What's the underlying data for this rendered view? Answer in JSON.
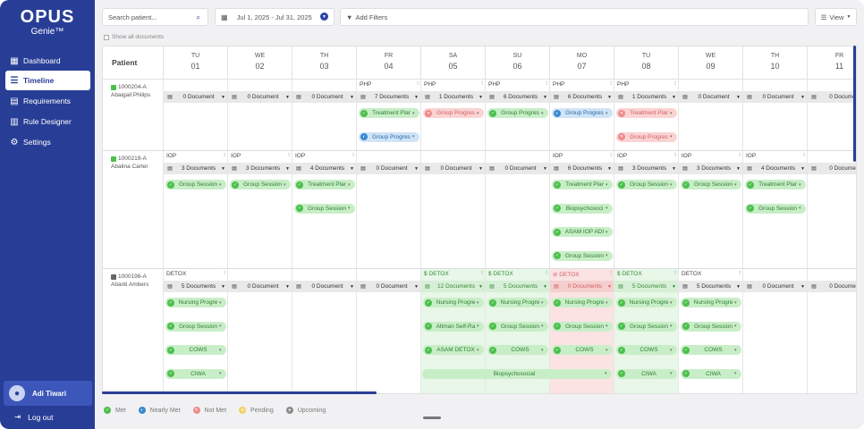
{
  "app": {
    "logo": "OPUS",
    "logo_sub": "Genie™"
  },
  "nav": [
    {
      "label": "Dashboard",
      "icon": "dashboard-icon"
    },
    {
      "label": "Timeline",
      "icon": "timeline-icon"
    },
    {
      "label": "Requirements",
      "icon": "requirements-icon"
    },
    {
      "label": "Rule Designer",
      "icon": "rule-designer-icon"
    },
    {
      "label": "Settings",
      "icon": "gear-icon"
    }
  ],
  "user": {
    "name": "Adi Tiwari",
    "logout": "Log out"
  },
  "toolbar": {
    "search_placeholder": "Search patient...",
    "date_range": "Jul 1, 2025 - Jul 31, 2025",
    "filters": "Add Filters",
    "view": "View"
  },
  "show_all": "Show all documents",
  "grid": {
    "patient_header": "Patient",
    "days": [
      {
        "name": "TU",
        "num": "01"
      },
      {
        "name": "WE",
        "num": "02"
      },
      {
        "name": "TH",
        "num": "03"
      },
      {
        "name": "FR",
        "num": "04"
      },
      {
        "name": "SA",
        "num": "05"
      },
      {
        "name": "SU",
        "num": "06"
      },
      {
        "name": "MO",
        "num": "07"
      },
      {
        "name": "TU",
        "num": "08"
      },
      {
        "name": "WE",
        "num": "09"
      },
      {
        "name": "TH",
        "num": "10"
      },
      {
        "name": "FR",
        "num": "11"
      }
    ],
    "patients": [
      {
        "id": "1000204-A",
        "name": "Abaigail Philips",
        "tag_color": "#4cbf4c",
        "cells": [
          {
            "prog": "",
            "docs": "0 Document",
            "chips": []
          },
          {
            "prog": "",
            "docs": "0 Document",
            "chips": []
          },
          {
            "prog": "",
            "docs": "0 Document",
            "chips": []
          },
          {
            "prog": "PHP",
            "docs": "7 Documents",
            "chips": [
              {
                "t": "Treatment Plar",
                "s": "met",
                "r": 0
              },
              {
                "t": "Group Progres",
                "s": "nearly",
                "r": 1
              }
            ]
          },
          {
            "prog": "PHP",
            "docs": "1 Documents",
            "chips": [
              {
                "t": "Group Progres",
                "s": "notmet",
                "r": 0
              }
            ]
          },
          {
            "prog": "PHP",
            "docs": "6 Documents",
            "chips": [
              {
                "t": "Group Progres",
                "s": "met",
                "r": 0
              }
            ]
          },
          {
            "prog": "PHP",
            "docs": "6 Documents",
            "chips": [
              {
                "t": "Group Progres",
                "s": "nearly",
                "r": 0
              }
            ]
          },
          {
            "prog": "PHP",
            "docs": "1 Documents",
            "chips": [
              {
                "t": "Treatment Plar",
                "s": "notmet",
                "r": 0
              },
              {
                "t": "Group Progres",
                "s": "notmet",
                "r": 1
              }
            ]
          },
          {
            "prog": "",
            "docs": "0 Document",
            "chips": []
          },
          {
            "prog": "",
            "docs": "0 Document",
            "chips": []
          },
          {
            "prog": "",
            "docs": "0 Docume",
            "chips": []
          }
        ]
      },
      {
        "id": "1000219-A",
        "name": "Abalina Carter",
        "tag_color": "#4cbf4c",
        "cells": [
          {
            "prog": "IOP",
            "docs": "3 Documents",
            "chips": [
              {
                "t": "Group Session",
                "s": "met",
                "r": 0
              }
            ]
          },
          {
            "prog": "IOP",
            "docs": "3 Documents",
            "chips": [
              {
                "t": "Group Session",
                "s": "met",
                "r": 0
              }
            ]
          },
          {
            "prog": "IOP",
            "docs": "4 Documents",
            "chips": [
              {
                "t": "Treatment Plar",
                "s": "met",
                "r": 0
              },
              {
                "t": "Group Session",
                "s": "met",
                "r": 1
              }
            ]
          },
          {
            "prog": "",
            "docs": "0 Document",
            "chips": []
          },
          {
            "prog": "",
            "docs": "0 Document",
            "chips": []
          },
          {
            "prog": "",
            "docs": "0 Document",
            "chips": []
          },
          {
            "prog": "IOP",
            "docs": "6 Documents",
            "chips": [
              {
                "t": "Treatment Plar",
                "s": "met",
                "r": 0
              },
              {
                "t": "Biopsychosoci",
                "s": "met",
                "r": 1
              },
              {
                "t": "ASAM IOP ADI",
                "s": "met",
                "r": 2
              },
              {
                "t": "Group Session",
                "s": "met",
                "r": 3
              }
            ]
          },
          {
            "prog": "IOP",
            "docs": "3 Documents",
            "chips": [
              {
                "t": "Group Session",
                "s": "met",
                "r": 0
              }
            ]
          },
          {
            "prog": "IOP",
            "docs": "3 Documents",
            "chips": [
              {
                "t": "Group Session",
                "s": "met",
                "r": 0
              }
            ]
          },
          {
            "prog": "IOP",
            "docs": "4 Documents",
            "chips": [
              {
                "t": "Treatment Plar",
                "s": "met",
                "r": 0
              },
              {
                "t": "Group Session",
                "s": "met",
                "r": 1
              }
            ]
          },
          {
            "prog": "",
            "docs": "0 Docume",
            "chips": []
          }
        ]
      },
      {
        "id": "1000196-A",
        "name": "Abanti Ambers",
        "tag_color": "#666666",
        "cells": [
          {
            "prog": "DETOX",
            "status": "",
            "docs": "5 Documents",
            "chips": [
              {
                "t": "Nursing Progre",
                "s": "met",
                "r": 0
              },
              {
                "t": "Group Session",
                "s": "met",
                "r": 1
              },
              {
                "t": "COWS",
                "s": "met",
                "r": 2
              },
              {
                "t": "CIWA",
                "s": "met",
                "r": 3
              }
            ]
          },
          {
            "prog": "",
            "status": "",
            "docs": "0 Document",
            "chips": []
          },
          {
            "prog": "",
            "status": "",
            "docs": "0 Document",
            "chips": []
          },
          {
            "prog": "",
            "status": "",
            "docs": "0 Document",
            "chips": []
          },
          {
            "prog": "$ DETOX",
            "status": "met",
            "docs": "12 Documents",
            "chips": [
              {
                "t": "Nursing Progre",
                "s": "met",
                "r": 0
              },
              {
                "t": "Altman Self-Ra",
                "s": "met",
                "r": 1
              },
              {
                "t": "ASAM DETOX",
                "s": "met",
                "r": 2
              }
            ]
          },
          {
            "prog": "$ DETOX",
            "status": "met",
            "docs": "5 Documents",
            "chips": [
              {
                "t": "Nursing Progre",
                "s": "met",
                "r": 0
              },
              {
                "t": "Group Session",
                "s": "met",
                "r": 1
              },
              {
                "t": "COWS",
                "s": "met",
                "r": 2
              }
            ]
          },
          {
            "prog": "⊘ DETOX",
            "status": "notmet",
            "docs": "0 Documents",
            "chips": [
              {
                "t": "Nursing Progre",
                "s": "met",
                "r": 0
              },
              {
                "t": "Group Session",
                "s": "met",
                "r": 1
              },
              {
                "t": "COWS",
                "s": "met",
                "r": 2
              }
            ]
          },
          {
            "prog": "$ DETOX",
            "status": "met",
            "docs": "5 Documents",
            "chips": [
              {
                "t": "Nursing Progre",
                "s": "met",
                "r": 0
              },
              {
                "t": "Group Session",
                "s": "met",
                "r": 1
              },
              {
                "t": "COWS",
                "s": "met",
                "r": 2
              },
              {
                "t": "CIWA",
                "s": "met",
                "r": 3
              }
            ]
          },
          {
            "prog": "DETOX",
            "status": "",
            "docs": "5 Documents",
            "chips": [
              {
                "t": "Nursing Progre",
                "s": "met",
                "r": 0
              },
              {
                "t": "Group Session",
                "s": "met",
                "r": 1
              },
              {
                "t": "COWS",
                "s": "met",
                "r": 2
              },
              {
                "t": "CIWA",
                "s": "met",
                "r": 3
              }
            ]
          },
          {
            "prog": "",
            "status": "",
            "docs": "0 Document",
            "chips": []
          },
          {
            "prog": "",
            "status": "",
            "docs": "0 Docume",
            "chips": []
          }
        ],
        "wide_chip": {
          "t": "Biopsychosocial",
          "s": "met",
          "from": 4,
          "span": 3,
          "r": 3
        }
      }
    ]
  },
  "legend": [
    {
      "label": "Met",
      "color": "#4cbf4c",
      "icon": "check-icon"
    },
    {
      "label": "Nearly Met",
      "color": "#3a8ad0",
      "icon": "partial-icon"
    },
    {
      "label": "Not Met",
      "color": "#ef8a8a",
      "icon": "cross-icon"
    },
    {
      "label": "Pending",
      "color": "#f1d36a",
      "icon": "pending-icon"
    },
    {
      "label": "Upcoming",
      "color": "#8a8a8a",
      "icon": "upcoming-icon"
    }
  ],
  "colors": {
    "sidebar": "#283e96",
    "accent": "#2a44a8"
  }
}
